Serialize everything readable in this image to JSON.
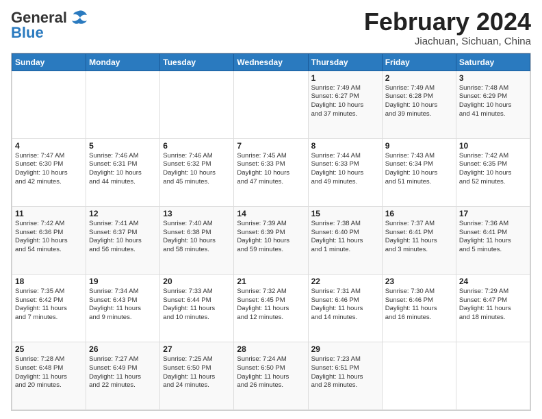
{
  "header": {
    "logo": {
      "general": "General",
      "blue": "Blue"
    },
    "title": "February 2024",
    "location": "Jiachuan, Sichuan, China"
  },
  "weekdays": [
    "Sunday",
    "Monday",
    "Tuesday",
    "Wednesday",
    "Thursday",
    "Friday",
    "Saturday"
  ],
  "weeks": [
    [
      {
        "day": "",
        "info": ""
      },
      {
        "day": "",
        "info": ""
      },
      {
        "day": "",
        "info": ""
      },
      {
        "day": "",
        "info": ""
      },
      {
        "day": "1",
        "info": "Sunrise: 7:49 AM\nSunset: 6:27 PM\nDaylight: 10 hours\nand 37 minutes."
      },
      {
        "day": "2",
        "info": "Sunrise: 7:49 AM\nSunset: 6:28 PM\nDaylight: 10 hours\nand 39 minutes."
      },
      {
        "day": "3",
        "info": "Sunrise: 7:48 AM\nSunset: 6:29 PM\nDaylight: 10 hours\nand 41 minutes."
      }
    ],
    [
      {
        "day": "4",
        "info": "Sunrise: 7:47 AM\nSunset: 6:30 PM\nDaylight: 10 hours\nand 42 minutes."
      },
      {
        "day": "5",
        "info": "Sunrise: 7:46 AM\nSunset: 6:31 PM\nDaylight: 10 hours\nand 44 minutes."
      },
      {
        "day": "6",
        "info": "Sunrise: 7:46 AM\nSunset: 6:32 PM\nDaylight: 10 hours\nand 45 minutes."
      },
      {
        "day": "7",
        "info": "Sunrise: 7:45 AM\nSunset: 6:33 PM\nDaylight: 10 hours\nand 47 minutes."
      },
      {
        "day": "8",
        "info": "Sunrise: 7:44 AM\nSunset: 6:33 PM\nDaylight: 10 hours\nand 49 minutes."
      },
      {
        "day": "9",
        "info": "Sunrise: 7:43 AM\nSunset: 6:34 PM\nDaylight: 10 hours\nand 51 minutes."
      },
      {
        "day": "10",
        "info": "Sunrise: 7:42 AM\nSunset: 6:35 PM\nDaylight: 10 hours\nand 52 minutes."
      }
    ],
    [
      {
        "day": "11",
        "info": "Sunrise: 7:42 AM\nSunset: 6:36 PM\nDaylight: 10 hours\nand 54 minutes."
      },
      {
        "day": "12",
        "info": "Sunrise: 7:41 AM\nSunset: 6:37 PM\nDaylight: 10 hours\nand 56 minutes."
      },
      {
        "day": "13",
        "info": "Sunrise: 7:40 AM\nSunset: 6:38 PM\nDaylight: 10 hours\nand 58 minutes."
      },
      {
        "day": "14",
        "info": "Sunrise: 7:39 AM\nSunset: 6:39 PM\nDaylight: 10 hours\nand 59 minutes."
      },
      {
        "day": "15",
        "info": "Sunrise: 7:38 AM\nSunset: 6:40 PM\nDaylight: 11 hours\nand 1 minute."
      },
      {
        "day": "16",
        "info": "Sunrise: 7:37 AM\nSunset: 6:41 PM\nDaylight: 11 hours\nand 3 minutes."
      },
      {
        "day": "17",
        "info": "Sunrise: 7:36 AM\nSunset: 6:41 PM\nDaylight: 11 hours\nand 5 minutes."
      }
    ],
    [
      {
        "day": "18",
        "info": "Sunrise: 7:35 AM\nSunset: 6:42 PM\nDaylight: 11 hours\nand 7 minutes."
      },
      {
        "day": "19",
        "info": "Sunrise: 7:34 AM\nSunset: 6:43 PM\nDaylight: 11 hours\nand 9 minutes."
      },
      {
        "day": "20",
        "info": "Sunrise: 7:33 AM\nSunset: 6:44 PM\nDaylight: 11 hours\nand 10 minutes."
      },
      {
        "day": "21",
        "info": "Sunrise: 7:32 AM\nSunset: 6:45 PM\nDaylight: 11 hours\nand 12 minutes."
      },
      {
        "day": "22",
        "info": "Sunrise: 7:31 AM\nSunset: 6:46 PM\nDaylight: 11 hours\nand 14 minutes."
      },
      {
        "day": "23",
        "info": "Sunrise: 7:30 AM\nSunset: 6:46 PM\nDaylight: 11 hours\nand 16 minutes."
      },
      {
        "day": "24",
        "info": "Sunrise: 7:29 AM\nSunset: 6:47 PM\nDaylight: 11 hours\nand 18 minutes."
      }
    ],
    [
      {
        "day": "25",
        "info": "Sunrise: 7:28 AM\nSunset: 6:48 PM\nDaylight: 11 hours\nand 20 minutes."
      },
      {
        "day": "26",
        "info": "Sunrise: 7:27 AM\nSunset: 6:49 PM\nDaylight: 11 hours\nand 22 minutes."
      },
      {
        "day": "27",
        "info": "Sunrise: 7:25 AM\nSunset: 6:50 PM\nDaylight: 11 hours\nand 24 minutes."
      },
      {
        "day": "28",
        "info": "Sunrise: 7:24 AM\nSunset: 6:50 PM\nDaylight: 11 hours\nand 26 minutes."
      },
      {
        "day": "29",
        "info": "Sunrise: 7:23 AM\nSunset: 6:51 PM\nDaylight: 11 hours\nand 28 minutes."
      },
      {
        "day": "",
        "info": ""
      },
      {
        "day": "",
        "info": ""
      }
    ]
  ]
}
